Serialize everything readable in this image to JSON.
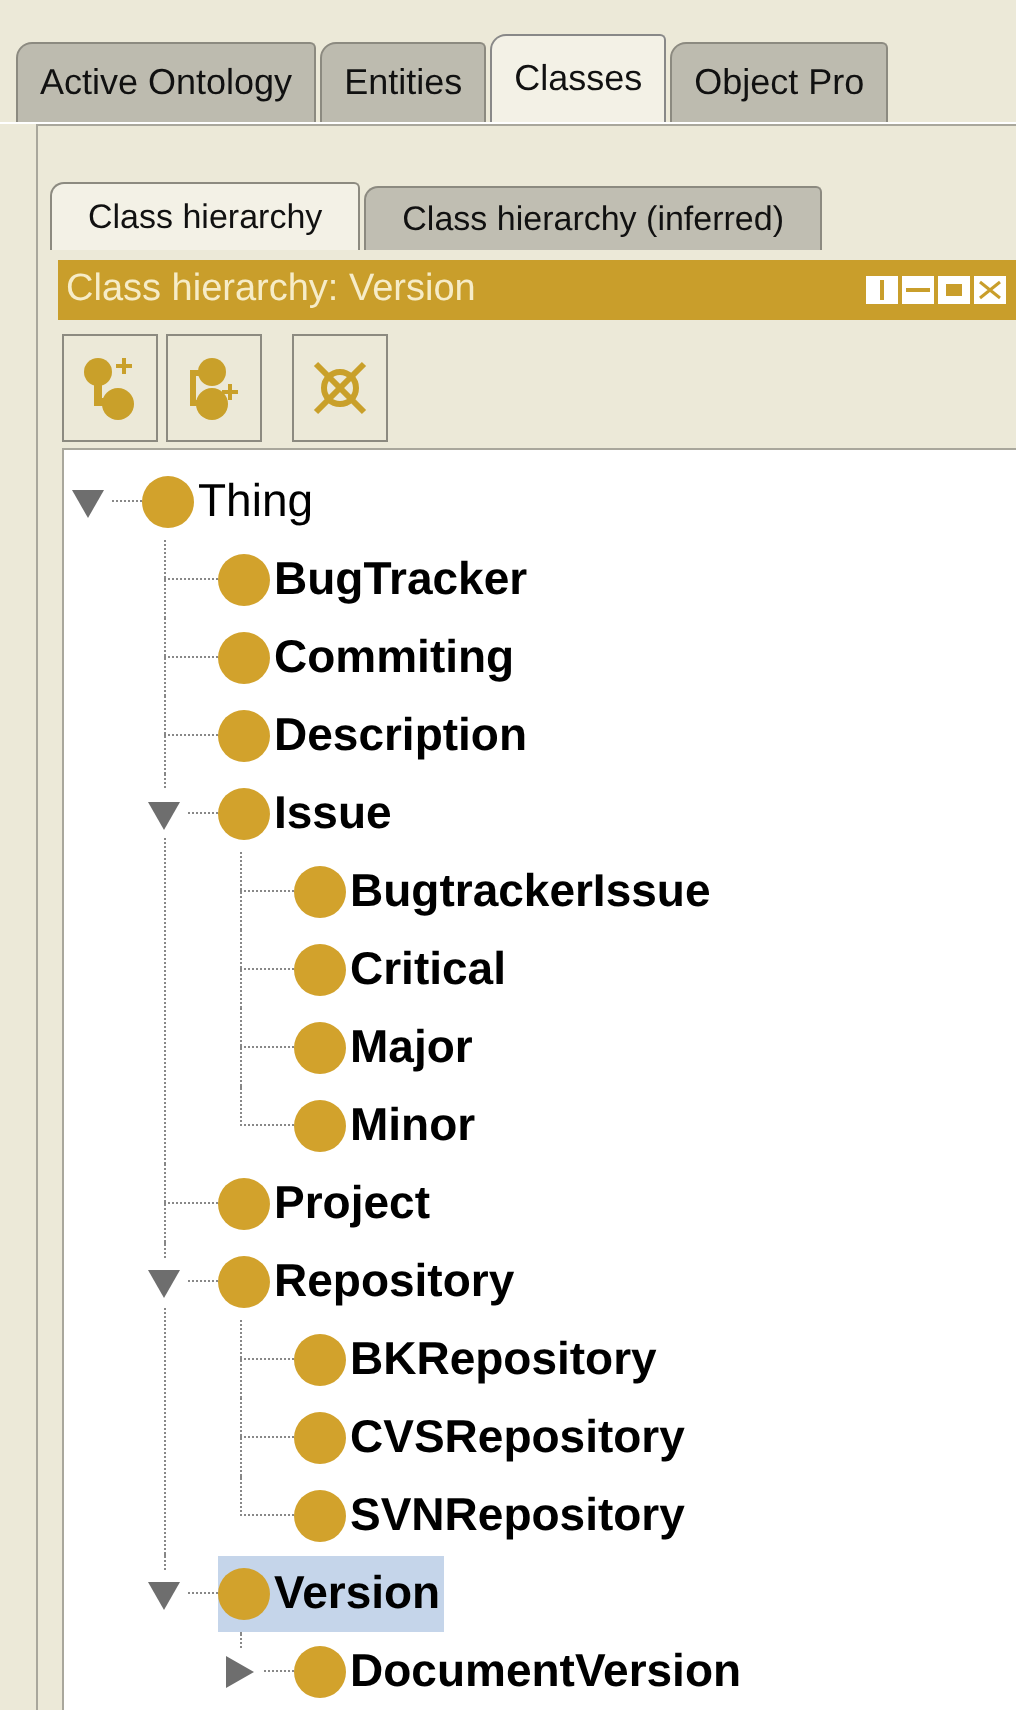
{
  "tabs": [
    {
      "label": "Active Ontology",
      "selected": false
    },
    {
      "label": "Entities",
      "selected": false
    },
    {
      "label": "Classes",
      "selected": true
    },
    {
      "label": "Object Pro",
      "selected": false
    }
  ],
  "view_tabs": [
    {
      "label": "Class hierarchy",
      "selected": true
    },
    {
      "label": "Class hierarchy (inferred)",
      "selected": false
    }
  ],
  "view": {
    "title": "Class hierarchy: Version"
  },
  "toolbar": [
    {
      "kind": "add-subclass"
    },
    {
      "kind": "add-sibling"
    },
    {
      "kind": "delete"
    }
  ],
  "tree": [
    {
      "label": "Thing",
      "kind": "branch",
      "expanded": true,
      "bold": false,
      "selected": false,
      "children": [
        {
          "label": "BugTracker",
          "kind": "leaf",
          "bold": true,
          "selected": false
        },
        {
          "label": "Commiting",
          "kind": "leaf",
          "bold": true,
          "selected": false
        },
        {
          "label": "Description",
          "kind": "leaf",
          "bold": true,
          "selected": false
        },
        {
          "label": "Issue",
          "kind": "branch",
          "expanded": true,
          "bold": true,
          "selected": false,
          "children": [
            {
              "label": "BugtrackerIssue",
              "kind": "leaf",
              "bold": true,
              "selected": false
            },
            {
              "label": "Critical",
              "kind": "leaf",
              "bold": true,
              "selected": false
            },
            {
              "label": "Major",
              "kind": "leaf",
              "bold": true,
              "selected": false
            },
            {
              "label": "Minor",
              "kind": "leaf",
              "bold": true,
              "selected": false
            }
          ]
        },
        {
          "label": "Project",
          "kind": "leaf",
          "bold": true,
          "selected": false
        },
        {
          "label": "Repository",
          "kind": "branch",
          "expanded": true,
          "bold": true,
          "selected": false,
          "children": [
            {
              "label": "BKRepository",
              "kind": "leaf",
              "bold": true,
              "selected": false
            },
            {
              "label": "CVSRepository",
              "kind": "leaf",
              "bold": true,
              "selected": false
            },
            {
              "label": "SVNRepository",
              "kind": "leaf",
              "bold": true,
              "selected": false
            }
          ]
        },
        {
          "label": "Version",
          "kind": "branch",
          "expanded": true,
          "bold": true,
          "selected": true,
          "children": [
            {
              "label": "DocumentVersion",
              "kind": "branch",
              "expanded": false,
              "bold": true,
              "selected": false
            }
          ]
        }
      ]
    }
  ]
}
